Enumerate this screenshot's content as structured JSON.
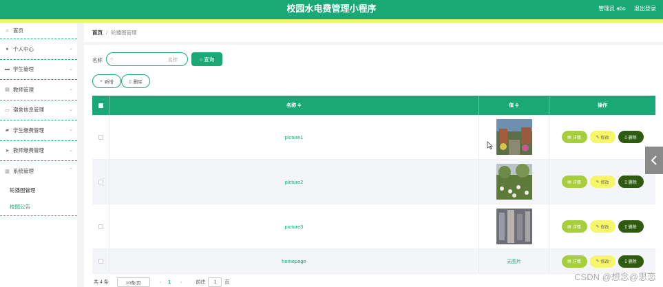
{
  "app": {
    "title": "校园水电费管理小程序",
    "user_label": "管理员 abo",
    "logout_label": "退出登录"
  },
  "sidebar": {
    "items": [
      {
        "label": "首页",
        "icon": "home-icon"
      },
      {
        "label": "个人中心",
        "icon": "user-icon"
      },
      {
        "label": "学生管理",
        "icon": "monitor-icon"
      },
      {
        "label": "教师管理",
        "icon": "document-icon"
      },
      {
        "label": "宿舍信息管理",
        "icon": "chat-icon"
      },
      {
        "label": "学生缴费管理",
        "icon": "wallet-icon"
      },
      {
        "label": "教师缴费管理",
        "icon": "send-icon"
      },
      {
        "label": "系统管理",
        "icon": "chart-icon"
      }
    ],
    "sub_items": [
      {
        "label": "轮播图管理"
      },
      {
        "label": "校园公告"
      }
    ]
  },
  "breadcrumb": {
    "home": "首页",
    "separator": "/",
    "current": "轮播图管理"
  },
  "search": {
    "label": "名称",
    "placeholder": "名称",
    "button_label": "查询"
  },
  "actions": {
    "add_label": "新增",
    "delete_label": "删除"
  },
  "table": {
    "headers": {
      "name": "名称 ≑",
      "value": "值 ≑",
      "operations": "操作"
    },
    "rows": [
      {
        "name": "picture1",
        "image": "picture1"
      },
      {
        "name": "picture2",
        "image": "picture2"
      },
      {
        "name": "picture3",
        "image": "picture3"
      },
      {
        "name": "homepage",
        "no_image_text": "无图片"
      }
    ],
    "row_buttons": {
      "detail": "详情",
      "edit": "修改",
      "delete": "删除"
    }
  },
  "pagination": {
    "total_text": "共 4 条",
    "page_size": "10条/页",
    "current_page": "1",
    "goto_label": "前往",
    "goto_value": "1",
    "page_unit": "页"
  },
  "watermark": "CSDN @想念@思恋",
  "colors": {
    "primary": "#1aa877",
    "accent_yellow": "#e8f66a",
    "detail_btn": "#a7cf3d",
    "edit_btn": "#f7f56a",
    "delete_btn": "#2f5b11"
  }
}
